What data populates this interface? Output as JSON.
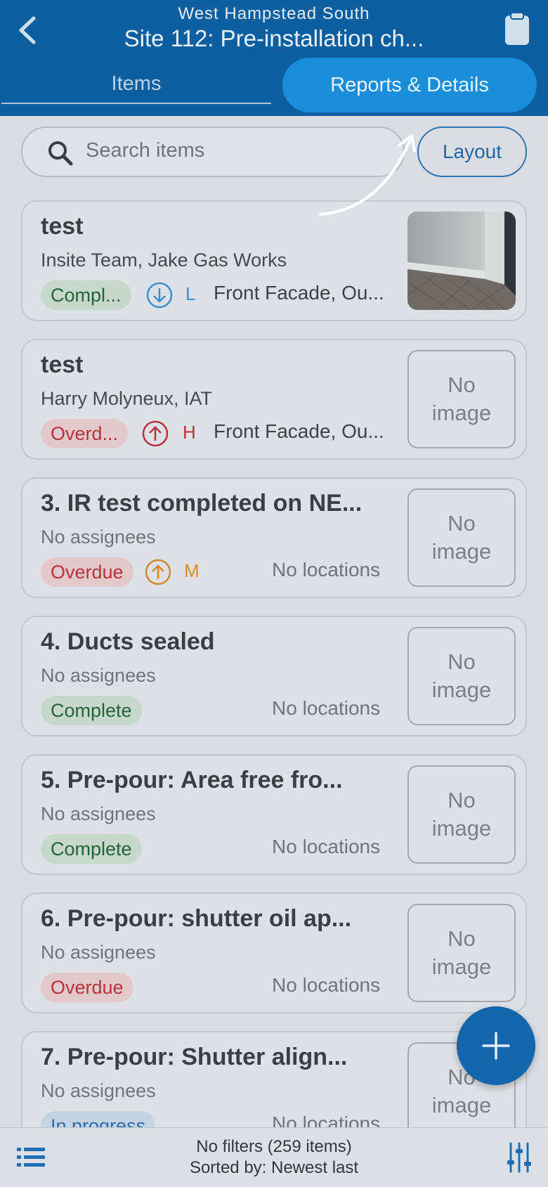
{
  "header": {
    "subtitle": "West Hampstead South",
    "title": "Site 112: Pre-installation ch...",
    "back_icon": "chevron-left-icon",
    "clipboard_icon": "clipboard-icon",
    "tabs": [
      {
        "label": "Items",
        "active": false
      },
      {
        "label": "Reports & Details",
        "active": true
      }
    ]
  },
  "search": {
    "placeholder": "Search items",
    "value": ""
  },
  "layout_button": "Layout",
  "items": [
    {
      "title": "test",
      "assignees": "Insite Team, Jake Gas Works",
      "status": "Compl...",
      "status_type": "complete",
      "priority": "L",
      "priority_dir": "down",
      "location": "Front Facade, Ou...",
      "image": true
    },
    {
      "title": "test",
      "assignees": "Harry Molyneux, IAT",
      "status": "Overd...",
      "status_type": "overdue",
      "priority": "H",
      "priority_dir": "up",
      "location": "Front Facade, Ou...",
      "image": false,
      "no_image_line1": "No",
      "no_image_line2": "image"
    },
    {
      "title": "3. IR test completed on NE...",
      "assignees": "No assignees",
      "status": "Overdue",
      "status_type": "overdue",
      "priority": "M",
      "priority_dir": "up",
      "location": "No locations",
      "image": false,
      "no_image_line1": "No",
      "no_image_line2": "image"
    },
    {
      "title": "4. Ducts sealed",
      "assignees": "No assignees",
      "status": "Complete",
      "status_type": "complete",
      "location": "No locations",
      "image": false,
      "no_image_line1": "No",
      "no_image_line2": "image"
    },
    {
      "title": "5. Pre-pour: Area free fro...",
      "assignees": "No assignees",
      "status": "Complete",
      "status_type": "complete",
      "location": "No locations",
      "image": false,
      "no_image_line1": "No",
      "no_image_line2": "image"
    },
    {
      "title": "6. Pre-pour: shutter oil ap...",
      "assignees": "No assignees",
      "status": "Overdue",
      "status_type": "overdue",
      "location": "No locations",
      "image": false,
      "no_image_line1": "No",
      "no_image_line2": "image"
    },
    {
      "title": "7. Pre-pour: Shutter align...",
      "assignees": "No assignees",
      "status": "In progress",
      "status_type": "in-progress",
      "location": "No locations",
      "image": false,
      "no_image_line1": "No",
      "no_image_line2": "image"
    }
  ],
  "fab_icon": "plus-icon",
  "footer": {
    "filters": "No filters (259 items)",
    "sorted": "Sorted by: Newest last",
    "list_icon": "list-icon",
    "filter_icon": "sliders-icon"
  },
  "colors": {
    "header_bg": "#0d5fa0",
    "active_tab": "#1a8edb",
    "complete": "#25623c",
    "overdue": "#b8323c",
    "priority_low": "#3a8fd0",
    "priority_high": "#b8323c",
    "priority_medium": "#d08a2a"
  }
}
